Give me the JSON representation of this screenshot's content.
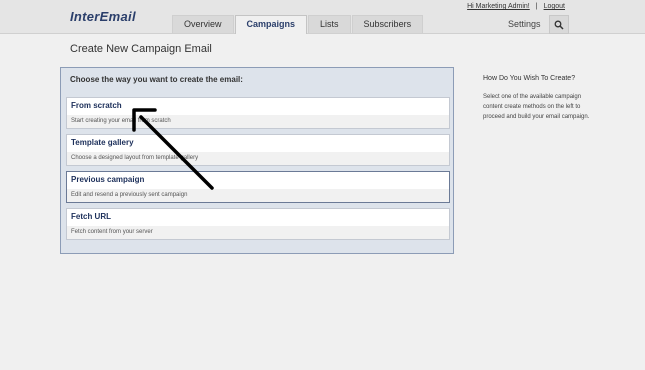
{
  "app": {
    "logo": "InterEmail"
  },
  "user": {
    "greeting": "Hi Marketing Admin!",
    "logout": "Logout"
  },
  "nav": {
    "tabs": [
      {
        "label": "Overview"
      },
      {
        "label": "Campaigns"
      },
      {
        "label": "Lists"
      },
      {
        "label": "Subscribers"
      }
    ],
    "active_tab": "Campaigns",
    "settings": "Settings"
  },
  "page": {
    "title": "Create New Campaign Email",
    "heading": "Choose the way you want to create the email:",
    "options": [
      {
        "title": "From scratch",
        "description": "Start creating your email from scratch"
      },
      {
        "title": "Template gallery",
        "description": "Choose a designed layout from template gallery"
      },
      {
        "title": "Previous campaign",
        "description": "Edit and resend a previously sent campaign"
      },
      {
        "title": "Fetch URL",
        "description": "Fetch content from your server"
      }
    ]
  },
  "sidebar": {
    "title": "How Do You Wish To Create?",
    "text": "Select one of the available campaign content create methods on the left to proceed and build your email campaign."
  },
  "colors": {
    "brand": "#2b3f6b",
    "panel_bg": "#dde3eb",
    "panel_border": "#8c9cb6"
  },
  "icons": {
    "search": "search-icon",
    "arrow": "arrow-annotation"
  }
}
